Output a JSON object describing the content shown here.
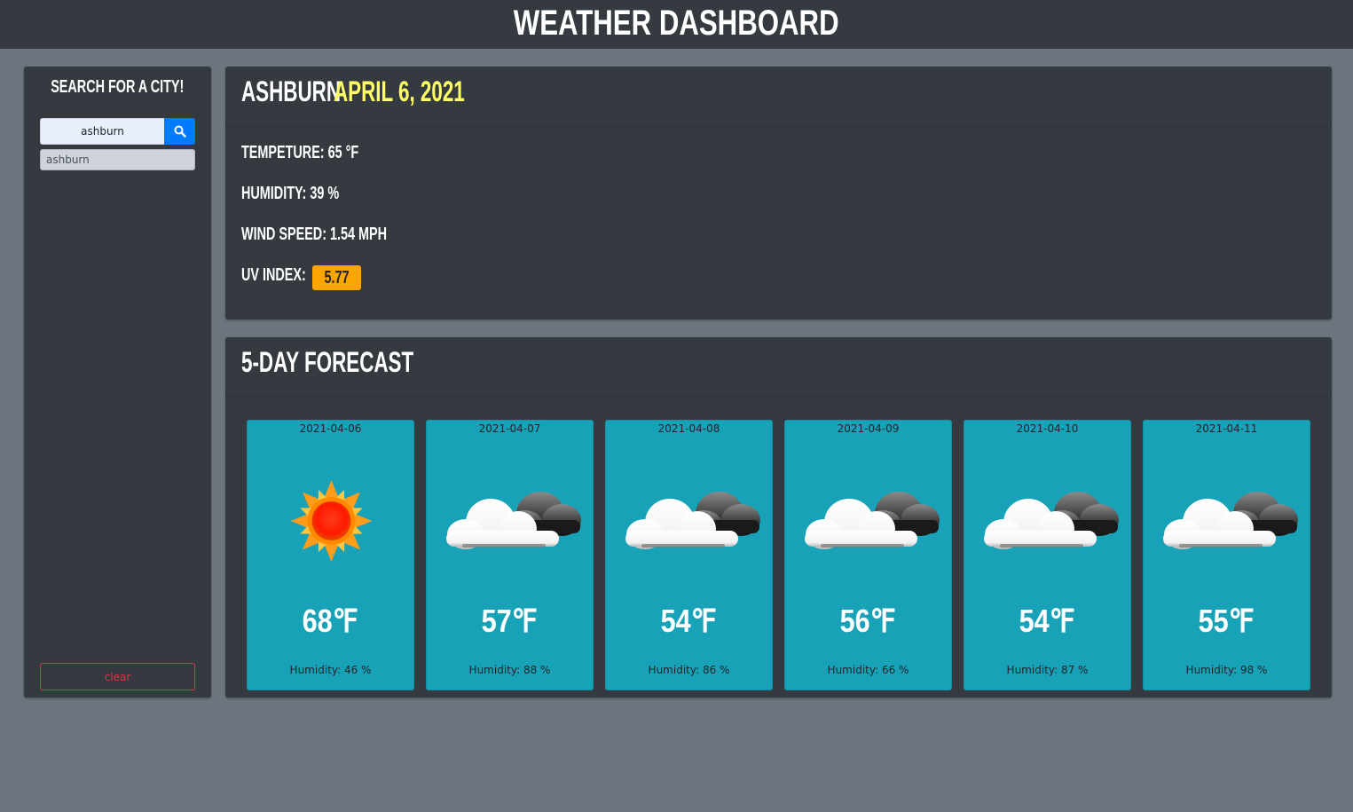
{
  "header": {
    "title": "WEATHER DASHBOARD"
  },
  "sidebar": {
    "heading": "SEARCH FOR A CITY!",
    "search_value": "ashburn",
    "history": [
      "ashburn"
    ],
    "clear_label": "clear"
  },
  "current": {
    "city": "ASHBURN",
    "date": "APRIL 6, 2021",
    "temperature": "TEMPETURE: 65 °F",
    "humidity": "HUMIDITY: 39 %",
    "wind": "WIND SPEED: 1.54 MPH",
    "uv_label": "UV INDEX:",
    "uv_value": "5.77",
    "uv_color": "#ffa500"
  },
  "forecast": {
    "title": "5-DAY FORECAST",
    "days": [
      {
        "date": "2021-04-06",
        "icon": "sun-icon",
        "temp": "68℉",
        "humidity": "Humidity: 46 %"
      },
      {
        "date": "2021-04-07",
        "icon": "cloudy-icon",
        "temp": "57℉",
        "humidity": "Humidity: 88 %"
      },
      {
        "date": "2021-04-08",
        "icon": "cloudy-icon",
        "temp": "54℉",
        "humidity": "Humidity: 86 %"
      },
      {
        "date": "2021-04-09",
        "icon": "cloudy-icon",
        "temp": "56℉",
        "humidity": "Humidity: 66 %"
      },
      {
        "date": "2021-04-10",
        "icon": "cloudy-icon",
        "temp": "54℉",
        "humidity": "Humidity: 87 %"
      },
      {
        "date": "2021-04-11",
        "icon": "cloudy-icon",
        "temp": "55℉",
        "humidity": "Humidity: 98 %"
      }
    ]
  }
}
